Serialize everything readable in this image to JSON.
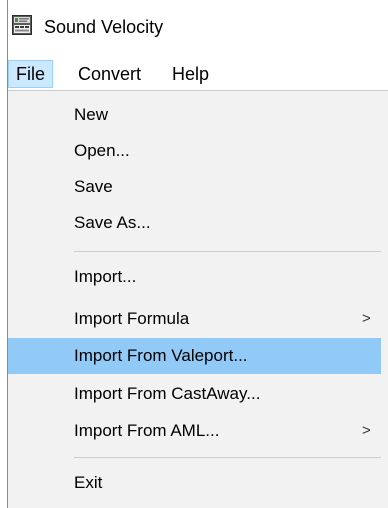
{
  "window": {
    "title": "Sound Velocity",
    "icon": "sound-velocity-app-icon"
  },
  "menubar": {
    "items": [
      {
        "label": "File",
        "active": true
      },
      {
        "label": "Convert",
        "active": false
      },
      {
        "label": "Help",
        "active": false
      }
    ]
  },
  "file_menu": {
    "items": [
      {
        "label": "New"
      },
      {
        "label": "Open..."
      },
      {
        "label": "Save"
      },
      {
        "label": "Save As..."
      },
      {
        "label": "Import..."
      },
      {
        "label": "Import Formula",
        "submenu": true
      },
      {
        "label": "Import From Valeport...",
        "highlighted": true
      },
      {
        "label": "Import From CastAway..."
      },
      {
        "label": "Import From AML...",
        "submenu": true
      },
      {
        "label": "Exit"
      }
    ],
    "submenu_glyph": ">",
    "highlight_color": "#91c9f7",
    "background_color": "#f2f2f2"
  }
}
